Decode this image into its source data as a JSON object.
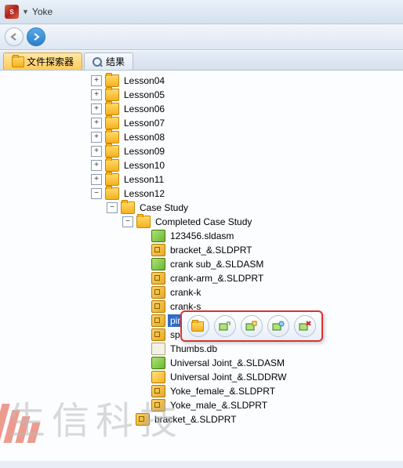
{
  "title": "Yoke",
  "tabs": {
    "explorer": "文件探索器",
    "results": "结果"
  },
  "tree": {
    "lessons": [
      "Lesson04",
      "Lesson05",
      "Lesson06",
      "Lesson07",
      "Lesson08",
      "Lesson09",
      "Lesson10",
      "Lesson11",
      "Lesson12"
    ],
    "case_study": "Case Study",
    "completed": "Completed Case Study",
    "files": [
      {
        "name": "123456.sldasm",
        "type": "asm"
      },
      {
        "name": "bracket_&.SLDPRT",
        "type": "part"
      },
      {
        "name": "crank sub_&.SLDASM",
        "type": "asm"
      },
      {
        "name": "crank-arm_&.SLDPRT",
        "type": "part"
      },
      {
        "name": "crank-k",
        "type": "part"
      },
      {
        "name": "crank-s",
        "type": "part"
      },
      {
        "name": "pin_&.SLDPRT",
        "type": "part",
        "selected": true
      },
      {
        "name": "spider_&.SLDPRT",
        "type": "part"
      },
      {
        "name": "Thumbs.db",
        "type": "db"
      },
      {
        "name": "Universal Joint_&.SLDASM",
        "type": "asm"
      },
      {
        "name": "Universal Joint_&.SLDDRW",
        "type": "drw"
      },
      {
        "name": "Yoke_female_&.SLDPRT",
        "type": "part"
      },
      {
        "name": "Yoke_male_&.SLDPRT",
        "type": "part"
      }
    ],
    "sibling": "bracket_&.SLDPRT"
  },
  "popup_actions": [
    "open",
    "insert",
    "insert-new",
    "config",
    "delete"
  ],
  "watermark": "生信科技"
}
